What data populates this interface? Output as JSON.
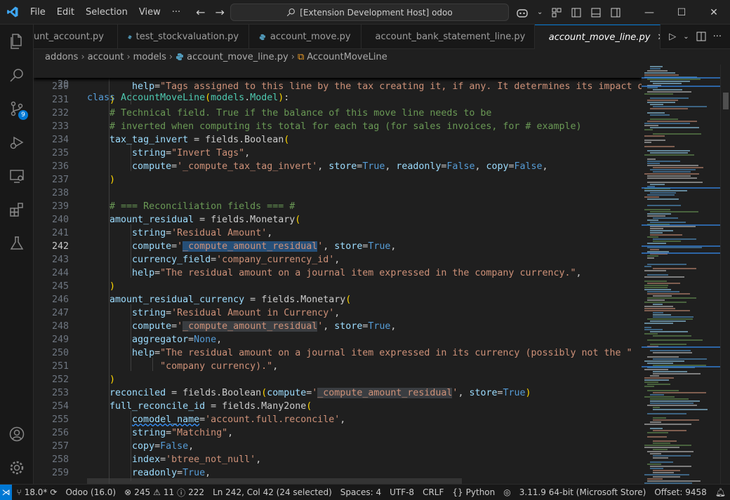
{
  "titlebar": {
    "menu": [
      "File",
      "Edit",
      "Selection",
      "View",
      "···"
    ],
    "search_text": "[Extension Development Host] odoo"
  },
  "activity": {
    "source_control_badge": "9"
  },
  "tabs": [
    {
      "label": "unt_account.py",
      "active": false
    },
    {
      "label": "test_stockvaluation.py",
      "active": false
    },
    {
      "label": "account_move.py",
      "active": false
    },
    {
      "label": "account_bank_statement_line.py",
      "active": false
    },
    {
      "label": "account_move_line.py",
      "active": true
    }
  ],
  "breadcrumb": [
    "addons",
    "account",
    "models",
    "account_move_line.py",
    "AccountMoveLine"
  ],
  "editor": {
    "sticky_line_number": "20",
    "line_numbers": [
      "230",
      "231",
      "232",
      "233",
      "234",
      "235",
      "236",
      "237",
      "238",
      "239",
      "240",
      "241",
      "242",
      "243",
      "244",
      "245",
      "246",
      "247",
      "248",
      "249",
      "250",
      "251",
      "252",
      "253",
      "254",
      "255",
      "256",
      "257",
      "258",
      "259"
    ]
  },
  "statusbar": {
    "branch": "18.0*",
    "env": "Odoo (16.0)",
    "errors": "245",
    "warnings": "11",
    "infos": "222",
    "position": "Ln 242, Col 42 (24 selected)",
    "spaces": "Spaces: 4",
    "encoding": "UTF-8",
    "eol": "CRLF",
    "language": "Python",
    "interpreter": "3.11.9 64-bit (Microsoft Store)",
    "offset": "Offset: 9458"
  },
  "colors": {
    "accent": "#0078d4",
    "background": "#1f1f1f",
    "keyword": "#569cd6",
    "string": "#ce9178",
    "comment": "#6a9955",
    "class": "#4ec9b0"
  }
}
